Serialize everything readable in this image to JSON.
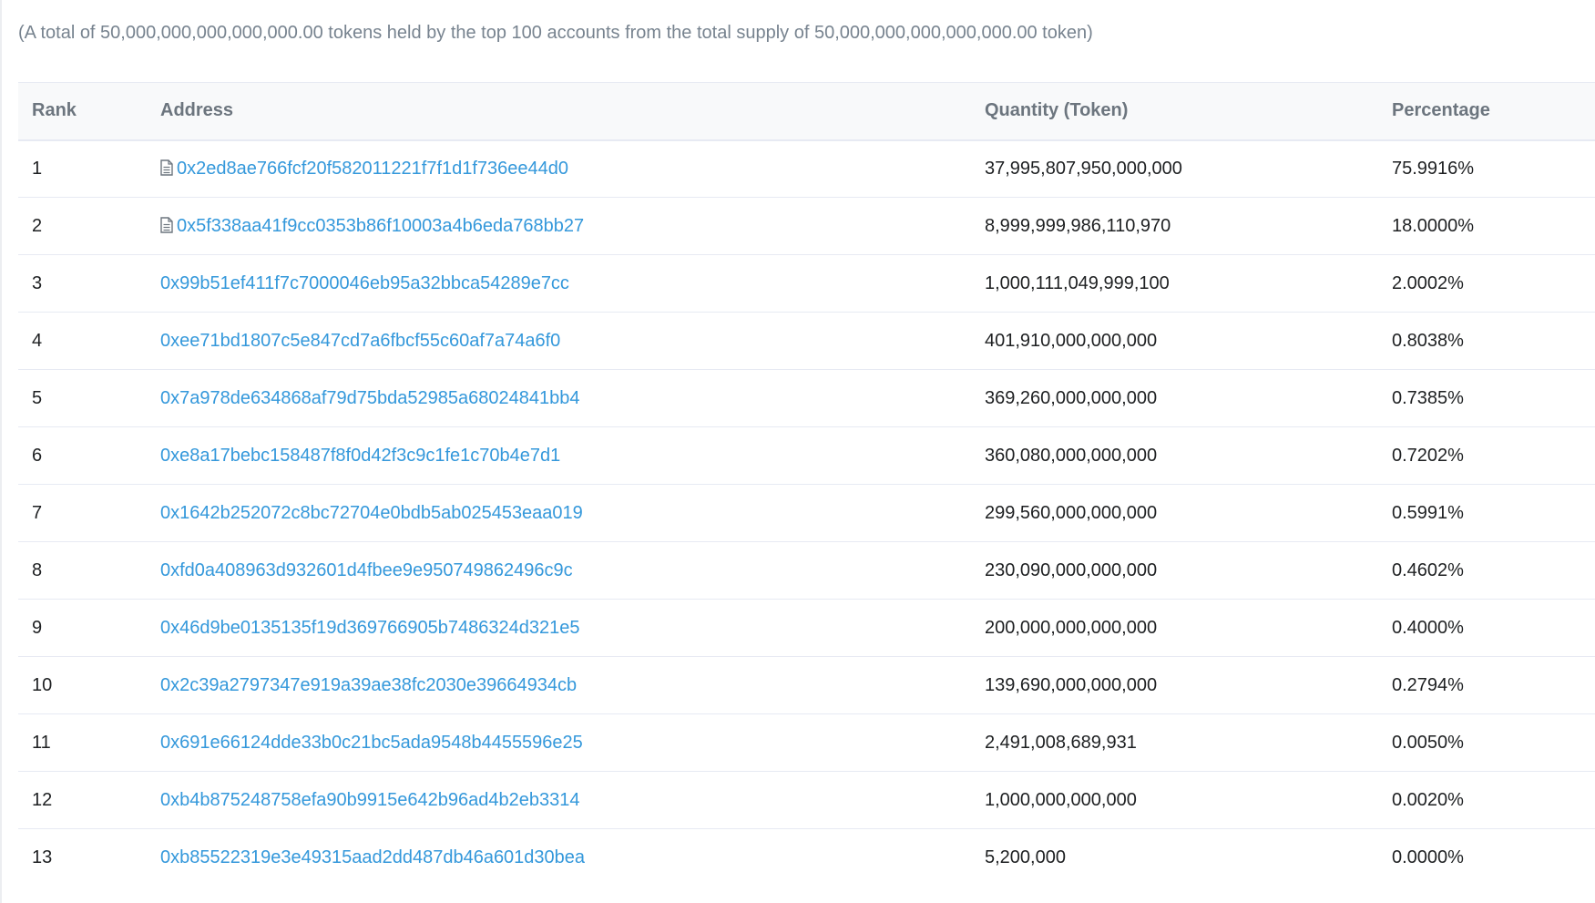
{
  "summary": "(A total of 50,000,000,000,000,000.00 tokens held by the top 100 accounts from the total supply of 50,000,000,000,000,000.00 token)",
  "table": {
    "headers": {
      "rank": "Rank",
      "address": "Address",
      "quantity": "Quantity (Token)",
      "percentage": "Percentage"
    },
    "rows": [
      {
        "rank": "1",
        "address": "0x2ed8ae766fcf20f582011221f7f1d1f736ee44d0",
        "is_contract": true,
        "quantity": "37,995,807,950,000,000",
        "percentage": "75.9916%"
      },
      {
        "rank": "2",
        "address": "0x5f338aa41f9cc0353b86f10003a4b6eda768bb27",
        "is_contract": true,
        "quantity": "8,999,999,986,110,970",
        "percentage": "18.0000%"
      },
      {
        "rank": "3",
        "address": "0x99b51ef411f7c7000046eb95a32bbca54289e7cc",
        "is_contract": false,
        "quantity": "1,000,111,049,999,100",
        "percentage": "2.0002%"
      },
      {
        "rank": "4",
        "address": "0xee71bd1807c5e847cd7a6fbcf55c60af7a74a6f0",
        "is_contract": false,
        "quantity": "401,910,000,000,000",
        "percentage": "0.8038%"
      },
      {
        "rank": "5",
        "address": "0x7a978de634868af79d75bda52985a68024841bb4",
        "is_contract": false,
        "quantity": "369,260,000,000,000",
        "percentage": "0.7385%"
      },
      {
        "rank": "6",
        "address": "0xe8a17bebc158487f8f0d42f3c9c1fe1c70b4e7d1",
        "is_contract": false,
        "quantity": "360,080,000,000,000",
        "percentage": "0.7202%"
      },
      {
        "rank": "7",
        "address": "0x1642b252072c8bc72704e0bdb5ab025453eaa019",
        "is_contract": false,
        "quantity": "299,560,000,000,000",
        "percentage": "0.5991%"
      },
      {
        "rank": "8",
        "address": "0xfd0a408963d932601d4fbee9e950749862496c9c",
        "is_contract": false,
        "quantity": "230,090,000,000,000",
        "percentage": "0.4602%"
      },
      {
        "rank": "9",
        "address": "0x46d9be0135135f19d369766905b7486324d321e5",
        "is_contract": false,
        "quantity": "200,000,000,000,000",
        "percentage": "0.4000%"
      },
      {
        "rank": "10",
        "address": "0x2c39a2797347e919a39ae38fc2030e39664934cb",
        "is_contract": false,
        "quantity": "139,690,000,000,000",
        "percentage": "0.2794%"
      },
      {
        "rank": "11",
        "address": "0x691e66124dde33b0c21bc5ada9548b4455596e25",
        "is_contract": false,
        "quantity": "2,491,008,689,931",
        "percentage": "0.0050%"
      },
      {
        "rank": "12",
        "address": "0xb4b875248758efa90b9915e642b96ad4b2eb3314",
        "is_contract": false,
        "quantity": "1,000,000,000,000",
        "percentage": "0.0020%"
      },
      {
        "rank": "13",
        "address": "0xb85522319e3e49315aad2dd487db46a601d30bea",
        "is_contract": false,
        "quantity": "5,200,000",
        "percentage": "0.0000%"
      }
    ]
  },
  "icons": {
    "contract": "file-text-icon"
  },
  "colors": {
    "link": "#3498db",
    "muted_text": "#77838f",
    "header_text": "#6c757e",
    "header_bg": "#f8f9fa",
    "border": "#e7eaf3",
    "body_text": "#1e2022"
  }
}
